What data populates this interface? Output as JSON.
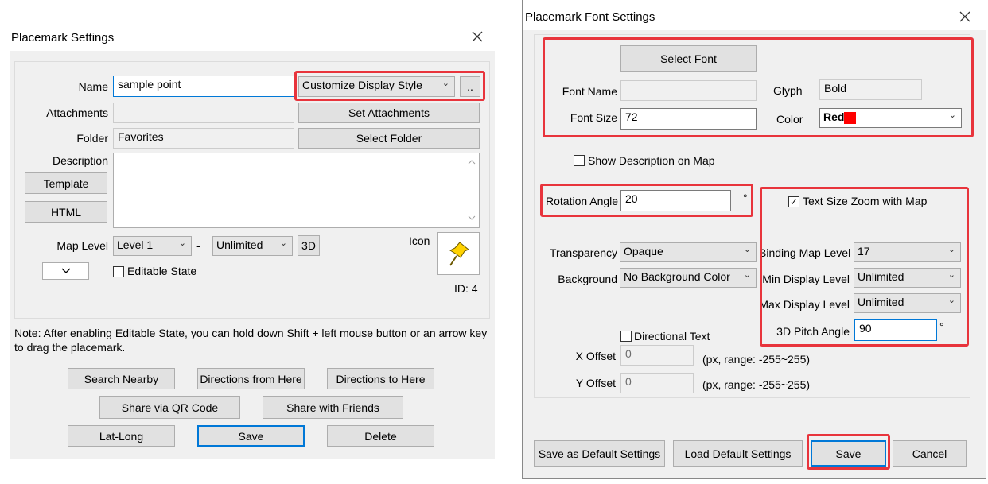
{
  "left": {
    "title": "Placemark Settings",
    "name_label": "Name",
    "name_value": "sample point",
    "style_combo": "Customize Display Style",
    "more_btn": "..",
    "attachments_label": "Attachments",
    "set_attachments_btn": "Set Attachments",
    "folder_label": "Folder",
    "folder_value": "Favorites",
    "select_folder_btn": "Select Folder",
    "description_label": "Description",
    "template_btn": "Template",
    "html_btn": "HTML",
    "map_level_label": "Map Level",
    "map_level_from": "Level 1",
    "dash": "-",
    "map_level_to": "Unlimited",
    "btn_3d": "3D",
    "icon_label": "Icon",
    "id_text": "ID: 4",
    "editable_label": "Editable State",
    "note": "Note: After enabling Editable State, you can hold down Shift + left mouse button or an arrow key to drag the placemark.",
    "search_nearby": "Search Nearby",
    "directions_from": "Directions from Here",
    "directions_to": "Directions to Here",
    "share_qr": "Share via QR Code",
    "share_friends": "Share with Friends",
    "lat_long": "Lat-Long",
    "save": "Save",
    "delete": "Delete"
  },
  "right": {
    "title": "Placemark Font Settings",
    "select_font_btn": "Select Font",
    "font_name_label": "Font Name",
    "font_name_value": "",
    "glyph_label": "Glyph",
    "glyph_value": "Bold",
    "font_size_label": "Font Size",
    "font_size_value": "72",
    "color_label": "Color",
    "color_value": "Red",
    "color_swatch": "#ff0000",
    "show_desc_label": "Show Description on Map",
    "rotation_label": "Rotation Angle",
    "rotation_value": "20",
    "degree": "°",
    "text_zoom_label": "Text Size Zoom with Map",
    "transparency_label": "Transparency",
    "transparency_value": "Opaque",
    "background_label": "Background",
    "background_value": "No Background Color",
    "binding_label": "Binding Map Level",
    "binding_value": "17",
    "min_display_label": "Min Display Level",
    "min_display_value": "Unlimited",
    "max_display_label": "Max Display Level",
    "max_display_value": "Unlimited",
    "pitch_label": "3D Pitch Angle",
    "pitch_value": "90",
    "directional_label": "Directional Text",
    "x_offset_label": "X Offset",
    "x_offset_value": "0",
    "y_offset_label": "Y Offset",
    "y_offset_value": "0",
    "range_text": "(px, range: -255~255)",
    "save_default": "Save as Default Settings",
    "load_default": "Load Default Settings",
    "save": "Save",
    "cancel": "Cancel"
  },
  "icons": {
    "close": "close-icon",
    "chevron": "chevron-down-icon",
    "pushpin": "pushpin-icon"
  },
  "colors": {
    "highlight": "#e8343c",
    "focus": "#0078d7",
    "pin": "#ffd200"
  }
}
